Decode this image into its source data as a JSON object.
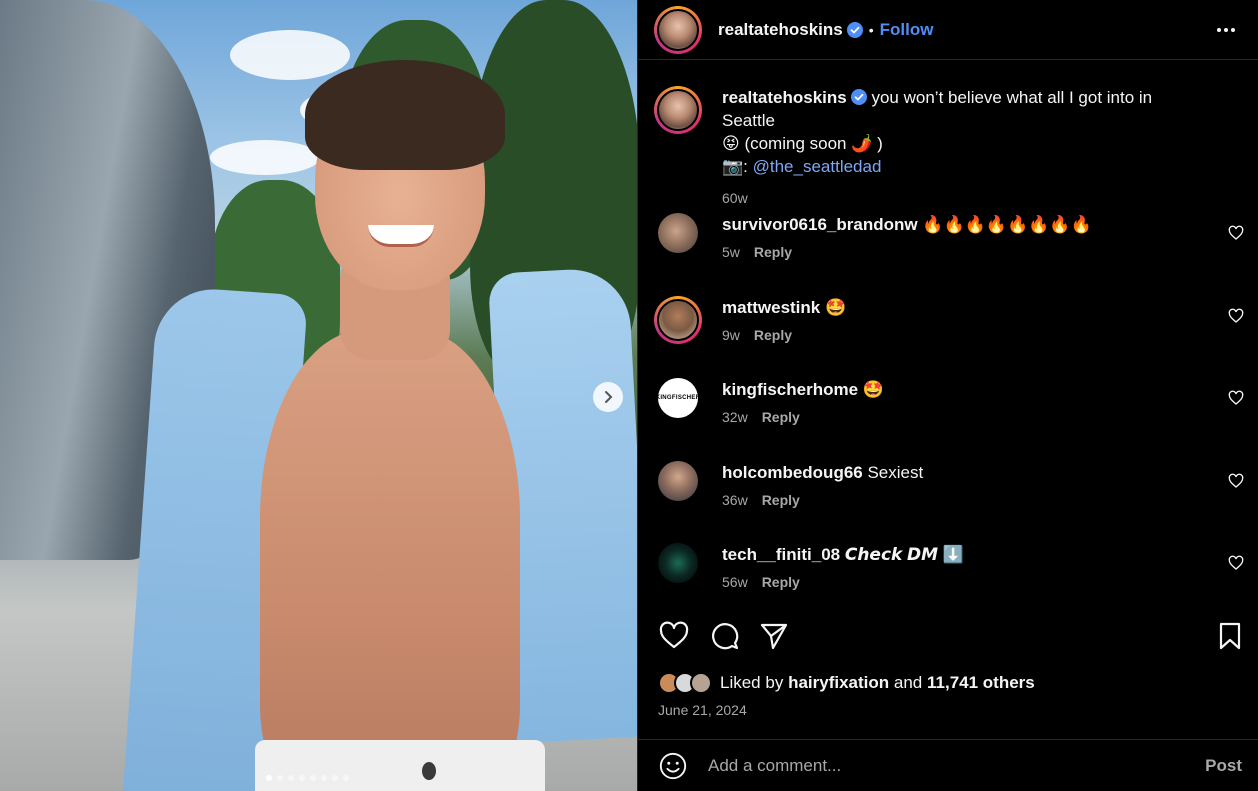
{
  "post": {
    "author": "realtatehoskins",
    "follow_label": "Follow",
    "separator": "•",
    "caption": {
      "username": "realtatehoskins",
      "text_line1": "you won’t believe what all I got into in Seattle",
      "text_line2": "😝 (coming soon 🌶️ )",
      "camera_prefix": "📷: ",
      "mention": "@the_seattledad",
      "time": "60w"
    },
    "photo_count": 8,
    "photo_index": 1
  },
  "comments": [
    {
      "username": "survivor0616_brandonw",
      "text": "🔥🔥🔥🔥🔥🔥🔥🔥",
      "time": "5w",
      "reply": "Reply"
    },
    {
      "username": "mattwestink",
      "text": "🤩",
      "time": "9w",
      "reply": "Reply"
    },
    {
      "username": "kingfischerhome",
      "text": "🤩",
      "time": "32w",
      "reply": "Reply"
    },
    {
      "username": "holcombedoug66",
      "text": "Sexiest",
      "time": "36w",
      "reply": "Reply"
    },
    {
      "username": "tech__finiti_08",
      "text": "𝘾𝙝𝙚𝙘𝙠 𝘿𝙈 ⬇️",
      "time": "56w",
      "reply": "Reply"
    }
  ],
  "likes": {
    "prefix": "Liked by",
    "user": "hairyfixation",
    "conj": "and",
    "others": "11,741 others"
  },
  "date": "June 21, 2024",
  "composer": {
    "placeholder": "Add a comment...",
    "post_label": "Post"
  },
  "kingfischer_logo": "KINGFISCHER",
  "colors": {
    "accent": "#4f8ef7",
    "mention": "#7da8f5",
    "background": "#000000",
    "muted": "#a8a8a8"
  }
}
